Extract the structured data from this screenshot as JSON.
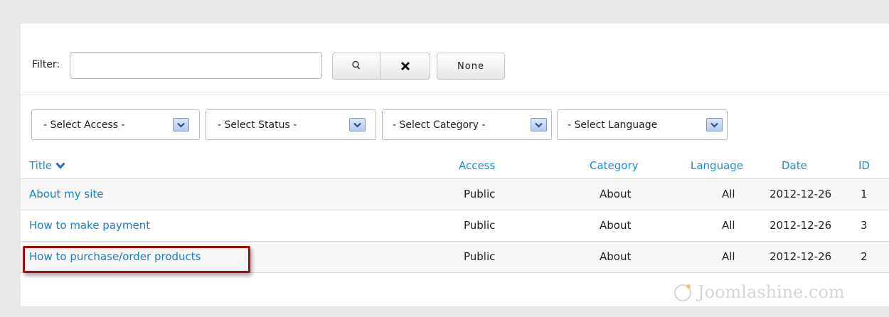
{
  "filter": {
    "label": "Filter:",
    "value": "",
    "placeholder": "",
    "search_icon": "search-icon",
    "clear_icon": "close-icon",
    "none_label": "None"
  },
  "selects": {
    "access": "- Select Access -",
    "status": "- Select Status -",
    "category": "- Select Category -",
    "language": "- Select Language"
  },
  "table": {
    "headers": {
      "title": "Title",
      "access": "Access",
      "category": "Category",
      "language": "Language",
      "date": "Date",
      "id": "ID"
    },
    "rows": [
      {
        "title": "About my site",
        "access": "Public",
        "category": "About",
        "language": "All",
        "date": "2012-12-26",
        "id": "1"
      },
      {
        "title": "How to make payment",
        "access": "Public",
        "category": "About",
        "language": "All",
        "date": "2012-12-26",
        "id": "3"
      },
      {
        "title": "How to purchase/order products",
        "access": "Public",
        "category": "About",
        "language": "All",
        "date": "2012-12-26",
        "id": "2"
      }
    ]
  },
  "watermark": "Joomlashine.com",
  "colors": {
    "link": "#1a7fc0",
    "header_link": "#1a8fd1",
    "highlight": "#a30f0f",
    "background": "#e8e8e8"
  }
}
